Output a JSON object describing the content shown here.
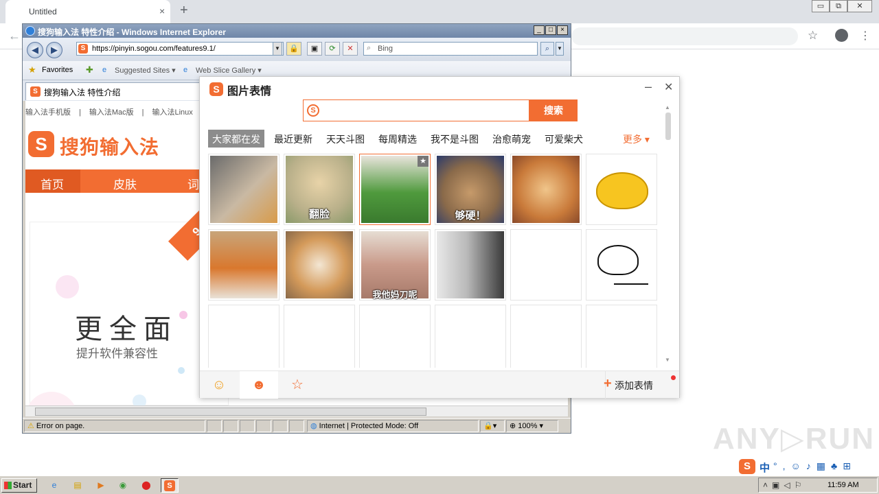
{
  "chrome": {
    "tab_title": "Untitled",
    "tab_close": "×",
    "new_tab": "+",
    "back": "←",
    "star": "☆",
    "menu": "⋮",
    "win_min": "▭",
    "win_restore": "⧉",
    "win_close": "✕"
  },
  "ie": {
    "title": "搜狗输入法 特性介绍 - Windows Internet Explorer",
    "address": "https://pinyin.sogou.com/features9.1/",
    "search_placeholder": "Bing",
    "favorites_label": "Favorites",
    "suggested_sites": "Suggested Sites ▾",
    "web_slice_gallery": "Web Slice Gallery ▾",
    "tab_title": "搜狗输入法 特性介绍",
    "status_error": "Error on page.",
    "status_zone": "Internet | Protected Mode: Off",
    "zoom": "100%"
  },
  "page": {
    "topnav": [
      "输入法手机版",
      "|",
      "输入法Mac版",
      "|",
      "输入法Linux"
    ],
    "logo_text": "搜狗输入法",
    "nav": [
      "首页",
      "皮肤",
      "词"
    ],
    "ribbon": "9.3版",
    "big_title": "更全面",
    "sub_title": "提升软件兼容性"
  },
  "panel": {
    "title": "图片表情",
    "search_button": "搜索",
    "categories": [
      "大家都在发",
      "最近更新",
      "天天斗图",
      "每周精选",
      "我不是斗图",
      "治愈萌宠",
      "可爱柴犬"
    ],
    "more": "更多 ▾",
    "captions": {
      "item2": "翻脸",
      "item4": "够硬！",
      "item9": "我他妈刀呢"
    },
    "add_emoji": "添加表情",
    "colors": {
      "accent": "#f26d32"
    }
  },
  "taskbar": {
    "start": "Start",
    "clock": "11:59 AM",
    "ime_mode": "中"
  },
  "watermark": "ANY▷RUN"
}
